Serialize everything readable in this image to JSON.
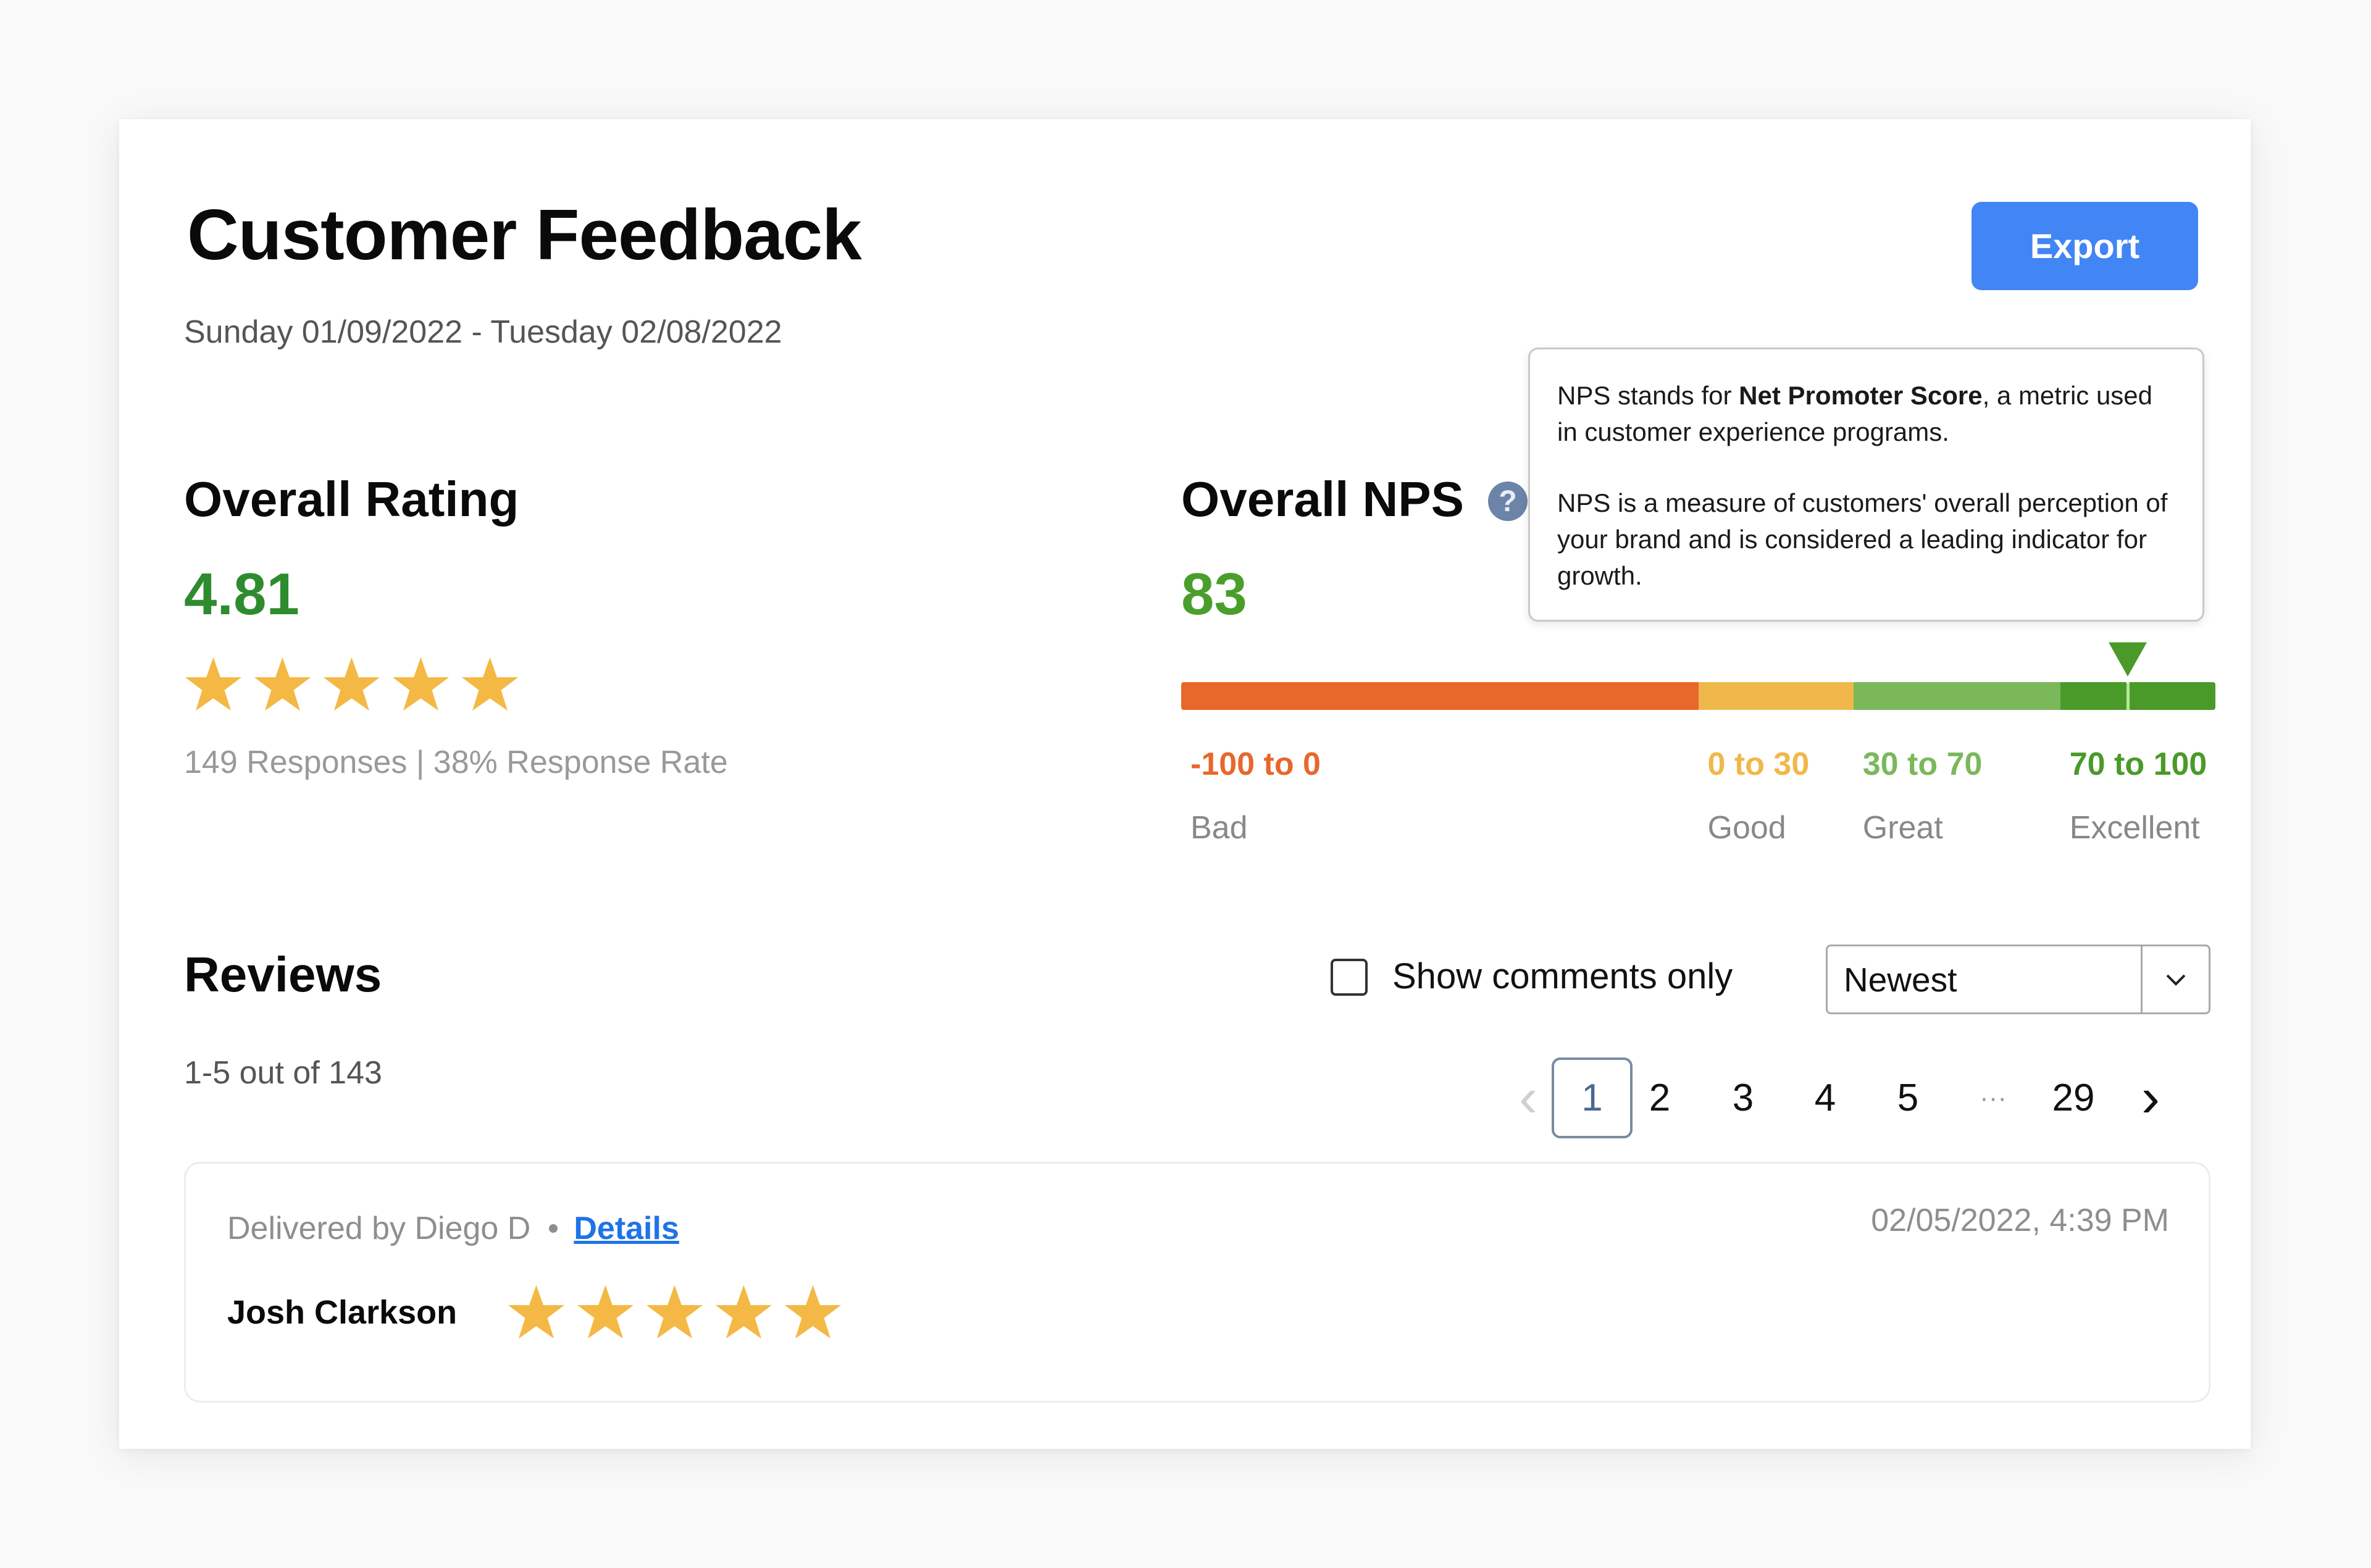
{
  "header": {
    "title": "Customer Feedback",
    "date_range": "Sunday 01/09/2022 - Tuesday 02/08/2022",
    "export_label": "Export",
    "export_color": "#4285f4"
  },
  "overall_rating": {
    "heading": "Overall Rating",
    "value": "4.81",
    "stars_filled": 5,
    "stars_total": 5,
    "responses": "149 Responses",
    "response_rate": "38% Response Rate",
    "separator": "|",
    "value_color": "#2e8b2e",
    "star_color": "#f4b844"
  },
  "overall_nps": {
    "heading": "Overall NPS",
    "help_icon_glyph": "?",
    "value": "83",
    "value_numeric": 83,
    "scale_min": -100,
    "scale_max": 100,
    "value_color": "#4a9e2a",
    "ranges": [
      {
        "range": "-100 to 0",
        "name": "Bad",
        "from": -100,
        "to": 0,
        "color": "#e8672b"
      },
      {
        "range": "0 to 30",
        "name": "Good",
        "from": 0,
        "to": 30,
        "color": "#f0b84a"
      },
      {
        "range": "30 to 70",
        "name": "Great",
        "from": 30,
        "to": 70,
        "color": "#7ab85a"
      },
      {
        "range": "70 to 100",
        "name": "Excellent",
        "from": 70,
        "to": 100,
        "color": "#4a9a2a"
      }
    ],
    "tooltip": {
      "p1_before": "NPS stands for ",
      "p1_bold": "Net Promoter Score",
      "p1_after": ", a metric used in customer experience programs.",
      "p2": "NPS is a measure of customers' overall perception of your brand and is considered a leading indicator for growth."
    }
  },
  "reviews": {
    "heading": "Reviews",
    "count_text": "1-5 out of 143",
    "show_comments_label": "Show comments only",
    "show_comments_checked": false,
    "sort_selected": "Newest",
    "pagination": {
      "prev_glyph": "‹",
      "next_glyph": "›",
      "pages": [
        "1",
        "2",
        "3",
        "4",
        "5",
        "···",
        "29"
      ],
      "current": "1"
    },
    "items": [
      {
        "delivered_by": "Delivered by Diego D",
        "details_label": "Details",
        "timestamp": "02/05/2022, 4:39 PM",
        "customer": "Josh Clarkson",
        "stars": 5
      }
    ]
  }
}
